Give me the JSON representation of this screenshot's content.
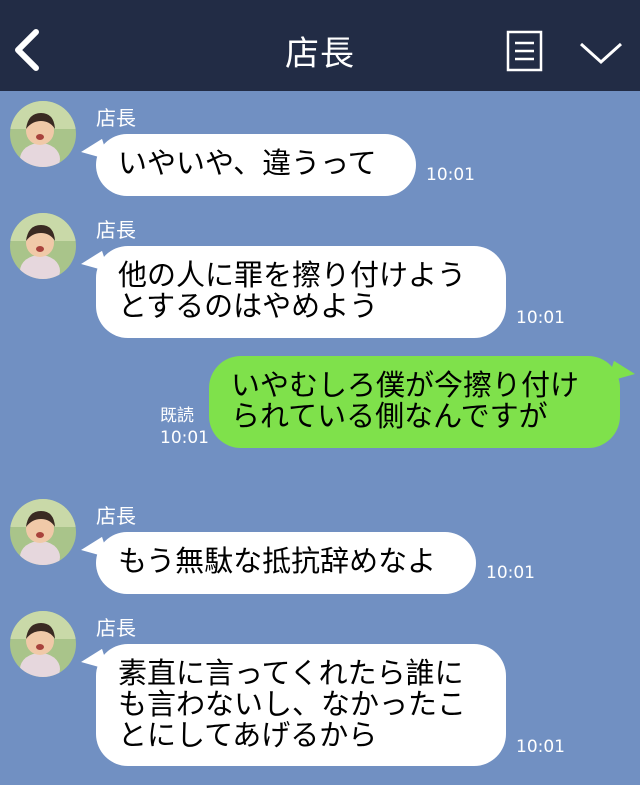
{
  "header": {
    "title": "店長",
    "back_icon": "chevron-left-icon",
    "menu_icon": "menu-list-icon",
    "collapse_icon": "chevron-down-icon"
  },
  "messages": [
    {
      "sender": "店長",
      "text": "いやいや、違うって",
      "time": "10:01"
    },
    {
      "sender": "店長",
      "text": "他の人に罪を擦り付けよう\nとするのはやめよう",
      "time": "10:01"
    },
    {
      "text": "いやむしろ僕が今擦り付け\nられている側なんですが",
      "read": "既読",
      "time": "10:01"
    },
    {
      "sender": "店長",
      "text": "もう無駄な抵抗辞めなよ",
      "time": "10:01"
    },
    {
      "sender": "店長",
      "text": "素直に言ってくれたら誰に\nも言わないし、なかったこ\nとにしてあげるから",
      "time": "10:01"
    }
  ],
  "colors": {
    "background": "#7190c2",
    "header": "#222c45",
    "incoming_bubble": "#ffffff",
    "outgoing_bubble": "#7fe14b"
  }
}
